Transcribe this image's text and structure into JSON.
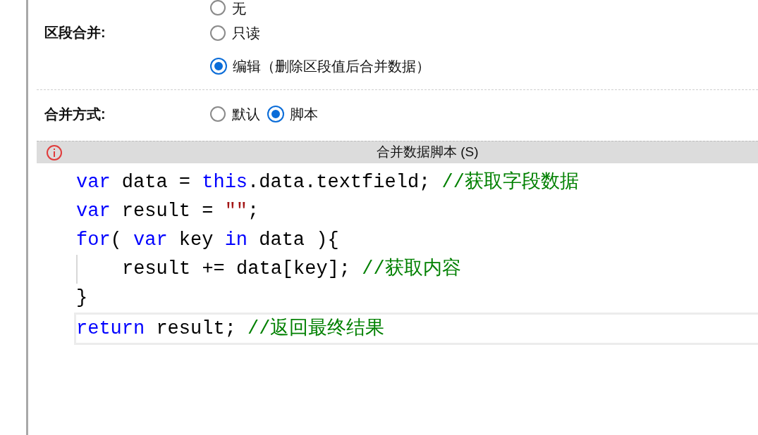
{
  "fields": [
    {
      "label": "区段合并:",
      "kind": "stacked",
      "options": [
        {
          "label": "无",
          "selected": false
        },
        {
          "label": "只读",
          "selected": false
        },
        {
          "label": "编辑（删除区段值后合并数据）",
          "selected": true
        }
      ]
    },
    {
      "label": "合并方式:",
      "kind": "inline",
      "options": [
        {
          "label": "默认",
          "selected": false
        },
        {
          "label": "脚本",
          "selected": true
        }
      ]
    }
  ],
  "script_panel": {
    "title": "合并数据脚本 (S)",
    "lines": [
      {
        "current": false,
        "tokens": [
          {
            "kind": "keyword",
            "text": "var"
          },
          {
            "kind": "plain",
            "text": " data = "
          },
          {
            "kind": "keyword",
            "text": "this"
          },
          {
            "kind": "plain",
            "text": ".data.textfield; "
          },
          {
            "kind": "comment",
            "text": "//获取字段数据"
          }
        ]
      },
      {
        "current": false,
        "tokens": [
          {
            "kind": "keyword",
            "text": "var"
          },
          {
            "kind": "plain",
            "text": " result = "
          },
          {
            "kind": "string",
            "text": "\"\""
          },
          {
            "kind": "plain",
            "text": ";"
          }
        ]
      },
      {
        "current": false,
        "tokens": [
          {
            "kind": "keyword",
            "text": "for"
          },
          {
            "kind": "plain",
            "text": "( "
          },
          {
            "kind": "keyword",
            "text": "var"
          },
          {
            "kind": "plain",
            "text": " key "
          },
          {
            "kind": "keyword",
            "text": "in"
          },
          {
            "kind": "plain",
            "text": " data ){"
          }
        ],
        "children": [
          {
            "current": false,
            "tokens": [
              {
                "kind": "plain",
                "text": "result += data[key]; "
              },
              {
                "kind": "comment",
                "text": "//获取内容"
              }
            ]
          }
        ]
      },
      {
        "current": false,
        "tokens": [
          {
            "kind": "plain",
            "text": "}"
          }
        ]
      },
      {
        "current": true,
        "tokens": [
          {
            "kind": "keyword",
            "text": "return"
          },
          {
            "kind": "plain",
            "text": " result; "
          },
          {
            "kind": "comment",
            "text": "//返回最终结果"
          }
        ]
      }
    ]
  }
}
